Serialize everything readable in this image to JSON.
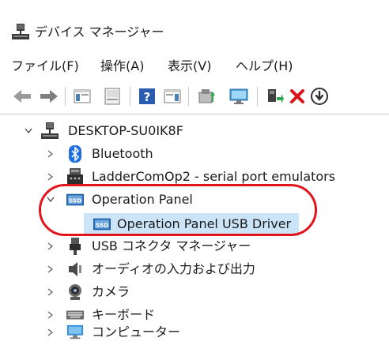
{
  "window": {
    "title": "デバイス マネージャー",
    "icon": "device-manager-icon"
  },
  "menu": {
    "items": [
      {
        "label": "ファイル(F)"
      },
      {
        "label": "操作(A)"
      },
      {
        "label": "表示(V)"
      },
      {
        "label": "ヘルプ(H)"
      }
    ]
  },
  "toolbar": {
    "buttons": [
      {
        "icon": "back-arrow-icon"
      },
      {
        "icon": "forward-arrow-icon"
      },
      {
        "icon": "properties-pane-icon"
      },
      {
        "icon": "properties-icon"
      },
      {
        "icon": "help-icon"
      },
      {
        "icon": "action-pane-icon"
      },
      {
        "icon": "update-driver-icon"
      },
      {
        "icon": "scan-hardware-icon"
      },
      {
        "icon": "enable-device-icon"
      },
      {
        "icon": "uninstall-icon"
      },
      {
        "icon": "disable-device-icon"
      }
    ]
  },
  "tree": {
    "root": {
      "label": "DESKTOP-SU0IK8F",
      "icon": "computer-tower-icon",
      "expanded": true
    },
    "nodes": [
      {
        "label": "Bluetooth",
        "icon": "bluetooth-icon",
        "expanded": false
      },
      {
        "label": "LadderComOp2 - serial port emulators",
        "icon": "serial-port-icon",
        "expanded": false
      },
      {
        "label": "Operation Panel",
        "icon": "operation-panel-icon",
        "expanded": true,
        "children": [
          {
            "label": "Operation Panel USB Driver",
            "icon": "operation-panel-icon",
            "selected": true
          }
        ]
      },
      {
        "label": "USB コネクタ マネージャー",
        "icon": "usb-connector-icon",
        "expanded": false
      },
      {
        "label": "オーディオの入力および出力",
        "icon": "speaker-icon",
        "expanded": false
      },
      {
        "label": "カメラ",
        "icon": "camera-icon",
        "expanded": false
      },
      {
        "label": "キーボード",
        "icon": "keyboard-icon",
        "expanded": false
      },
      {
        "label": "コンピューター",
        "icon": "monitor-icon",
        "expanded": false
      }
    ]
  },
  "colors": {
    "selection": "#cce4f7",
    "annotation": "#e3141c",
    "bluetooth": "#1f6fe0",
    "delete": "#d9151b"
  }
}
